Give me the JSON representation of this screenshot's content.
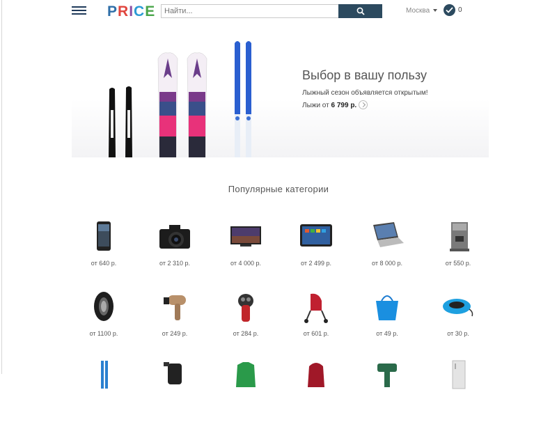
{
  "header": {
    "logo": [
      "P",
      "R",
      "I",
      "C",
      "E"
    ],
    "search_placeholder": "Найти...",
    "city": "Москва",
    "compare_count": "0"
  },
  "banner": {
    "title": "Выбор в вашу пользу",
    "subtitle": "Лыжный сезон объявляется открытым!",
    "price_prefix": "Лыжи от",
    "price_value": "6 799 р."
  },
  "categories_title": "Популярные категории",
  "categories": [
    {
      "icon": "smartphone-icon",
      "price": "от 640 р."
    },
    {
      "icon": "camera-icon",
      "price": "от 2 310 р."
    },
    {
      "icon": "tv-icon",
      "price": "от 4 000 р."
    },
    {
      "icon": "tablet-icon",
      "price": "от 2 499 р."
    },
    {
      "icon": "laptop-icon",
      "price": "от 8 000 р."
    },
    {
      "icon": "coffee-machine-icon",
      "price": "от 550 р."
    },
    {
      "icon": "tire-icon",
      "price": "от 1100 р."
    },
    {
      "icon": "hair-dryer-icon",
      "price": "от 249 р."
    },
    {
      "icon": "shaver-icon",
      "price": "от 284 р."
    },
    {
      "icon": "stroller-icon",
      "price": "от 601 р."
    },
    {
      "icon": "handbag-icon",
      "price": "от 49 р."
    },
    {
      "icon": "snow-tube-icon",
      "price": "от 30 р."
    }
  ],
  "colors": {
    "accent": "#2c4a5f",
    "logo": [
      "#2f6fa8",
      "#e0463e",
      "#8d4fa2",
      "#2b9bd4",
      "#4aa54a"
    ]
  }
}
